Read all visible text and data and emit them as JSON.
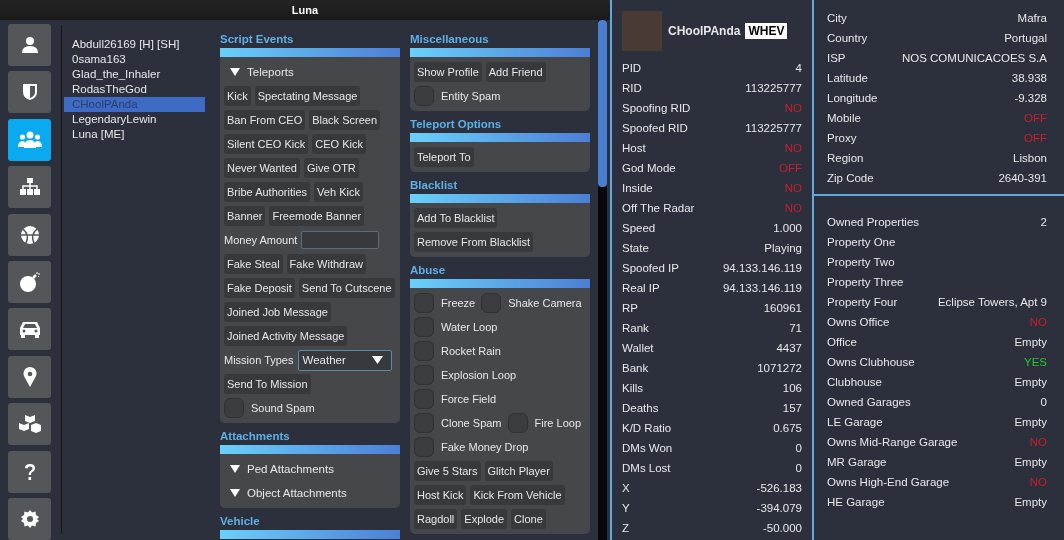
{
  "window": {
    "title": "Luna"
  },
  "sidebar": [
    {
      "kind": "person",
      "selected": false
    },
    {
      "kind": "shield",
      "selected": false
    },
    {
      "kind": "group",
      "selected": true
    },
    {
      "kind": "tree",
      "selected": false
    },
    {
      "kind": "ball",
      "selected": false
    },
    {
      "kind": "bomb",
      "selected": false
    },
    {
      "kind": "car",
      "selected": false
    },
    {
      "kind": "pin",
      "selected": false
    },
    {
      "kind": "boxes",
      "selected": false
    },
    {
      "kind": "help",
      "selected": false
    },
    {
      "kind": "gear",
      "selected": false
    }
  ],
  "players": [
    {
      "name": "Abdull26169 [H] [SH]",
      "selected": false
    },
    {
      "name": "0sama163",
      "selected": false
    },
    {
      "name": "Glad_the_Inhaler",
      "selected": false
    },
    {
      "name": "RodasTheGod",
      "selected": false
    },
    {
      "name": "CHoolPAnda",
      "selected": true
    },
    {
      "name": "LegendaryLewin",
      "selected": false
    },
    {
      "name": "Luna [ME]",
      "selected": false
    }
  ],
  "columns": [
    [
      {
        "title": "Script Events",
        "rows": [
          [
            {
              "kind": "expander",
              "label": "Teleports"
            }
          ],
          [
            {
              "kind": "button",
              "label": "Kick"
            },
            {
              "kind": "button",
              "label": "Spectating Message"
            }
          ],
          [
            {
              "kind": "button",
              "label": "Ban From CEO"
            },
            {
              "kind": "button",
              "label": "Black Screen"
            }
          ],
          [
            {
              "kind": "button",
              "label": "Silent CEO Kick"
            },
            {
              "kind": "button",
              "label": "CEO Kick"
            }
          ],
          [
            {
              "kind": "button",
              "label": "Never Wanted"
            },
            {
              "kind": "button",
              "label": "Give OTR"
            }
          ],
          [
            {
              "kind": "button",
              "label": "Bribe Authorities"
            },
            {
              "kind": "button",
              "label": "Veh Kick"
            }
          ],
          [
            {
              "kind": "button",
              "label": "Banner"
            },
            {
              "kind": "button",
              "label": "Freemode Banner"
            }
          ],
          [
            {
              "kind": "label",
              "label": "Money Amount"
            },
            {
              "kind": "field"
            }
          ],
          [
            {
              "kind": "button",
              "label": "Fake Steal"
            },
            {
              "kind": "button",
              "label": "Fake Withdraw"
            }
          ],
          [
            {
              "kind": "button",
              "label": "Fake Deposit"
            },
            {
              "kind": "button",
              "label": "Send To Cutscene"
            }
          ],
          [
            {
              "kind": "button",
              "label": "Joined Job Message"
            }
          ],
          [
            {
              "kind": "button",
              "label": "Joined Activity Message"
            }
          ],
          [
            {
              "kind": "label",
              "label": "Mission Types"
            },
            {
              "kind": "dropdown",
              "label": "Weather"
            }
          ],
          [
            {
              "kind": "button",
              "label": "Send To Mission"
            }
          ],
          [
            {
              "kind": "checkbox",
              "label": "Sound Spam",
              "checked": false
            }
          ]
        ]
      },
      {
        "title": "Attachments",
        "rows": [
          [
            {
              "kind": "expander",
              "label": "Ped Attachments"
            }
          ],
          [
            {
              "kind": "expander",
              "label": "Object Attachments"
            }
          ]
        ]
      },
      {
        "title": "Vehicle"
      }
    ],
    [
      {
        "title": "Miscellaneous",
        "rows": [
          [
            {
              "kind": "button",
              "label": "Show Profile"
            },
            {
              "kind": "button",
              "label": "Add Friend"
            }
          ],
          [
            {
              "kind": "checkbox",
              "label": "Entity Spam",
              "checked": false
            }
          ]
        ]
      },
      {
        "title": "Teleport Options",
        "rows": [
          [
            {
              "kind": "button",
              "label": "Teleport To"
            }
          ]
        ]
      },
      {
        "title": "Blacklist",
        "rows": [
          [
            {
              "kind": "button",
              "label": "Add To Blacklist"
            }
          ],
          [
            {
              "kind": "button",
              "label": "Remove From Blacklist"
            }
          ]
        ]
      },
      {
        "title": "Abuse",
        "rows": [
          [
            {
              "kind": "checkbox",
              "label": "Freeze",
              "checked": false
            },
            {
              "kind": "checkbox",
              "label": "Shake Camera",
              "checked": false
            }
          ],
          [
            {
              "kind": "checkbox",
              "label": "Water Loop",
              "checked": false
            }
          ],
          [
            {
              "kind": "checkbox",
              "label": "Rocket Rain",
              "checked": false
            }
          ],
          [
            {
              "kind": "checkbox",
              "label": "Explosion Loop",
              "checked": false
            }
          ],
          [
            {
              "kind": "checkbox",
              "label": "Force Field",
              "checked": false
            }
          ],
          [
            {
              "kind": "checkbox",
              "label": "Clone Spam",
              "checked": false
            },
            {
              "kind": "checkbox",
              "label": "Fire Loop",
              "checked": false
            }
          ],
          [
            {
              "kind": "checkbox",
              "label": "Fake Money Drop",
              "checked": false
            }
          ],
          [
            {
              "kind": "button",
              "label": "Give 5 Stars"
            },
            {
              "kind": "button",
              "label": "Glitch Player"
            }
          ],
          [
            {
              "kind": "button",
              "label": "Host Kick"
            },
            {
              "kind": "button",
              "label": "Kick From Vehicle"
            }
          ],
          [
            {
              "kind": "button",
              "label": "Ragdoll"
            },
            {
              "kind": "button",
              "label": "Explode"
            },
            {
              "kind": "button",
              "label": "Clone"
            }
          ]
        ]
      }
    ]
  ],
  "player_info": {
    "name": "CHoolPAnda",
    "tag": "WHEV",
    "stats": [
      {
        "label": "PID",
        "value": "4"
      },
      {
        "label": "RID",
        "value": "113225777"
      },
      {
        "label": "Spoofing RID",
        "value": "NO",
        "color": "#c8202a"
      },
      {
        "label": "Spoofed RID",
        "value": "113225777"
      },
      {
        "label": "Host",
        "value": "NO",
        "color": "#c8202a"
      },
      {
        "label": "God Mode",
        "value": "OFF",
        "color": "#c8202a"
      },
      {
        "label": "Inside",
        "value": "NO",
        "color": "#c8202a"
      },
      {
        "label": "Off The Radar",
        "value": "NO",
        "color": "#c8202a"
      },
      {
        "label": "Speed",
        "value": "1.000"
      },
      {
        "label": "State",
        "value": "Playing"
      },
      {
        "label": "Spoofed IP",
        "value": "94.133.146.119"
      },
      {
        "label": "Real IP",
        "value": "94.133.146.119"
      },
      {
        "label": "RP",
        "value": "160961"
      },
      {
        "label": "Rank",
        "value": "71"
      },
      {
        "label": "Wallet",
        "value": "4437"
      },
      {
        "label": "Bank",
        "value": "1071272"
      },
      {
        "label": "Kills",
        "value": "106"
      },
      {
        "label": "Deaths",
        "value": "157"
      },
      {
        "label": "K/D Ratio",
        "value": "0.675"
      },
      {
        "label": "DMs Won",
        "value": "0"
      },
      {
        "label": "DMs Lost",
        "value": "0"
      },
      {
        "label": "X",
        "value": "-526.183"
      },
      {
        "label": "Y",
        "value": "-394.079"
      },
      {
        "label": "Z",
        "value": "-50.000"
      }
    ]
  },
  "location": [
    {
      "label": "City",
      "value": "Mafra"
    },
    {
      "label": "Country",
      "value": "Portugal"
    },
    {
      "label": "ISP",
      "value": "NOS COMUNICACOES S.A"
    },
    {
      "label": "Latitude",
      "value": "38.938"
    },
    {
      "label": "Longitude",
      "value": "-9.328"
    },
    {
      "label": "Mobile",
      "value": "OFF",
      "color": "#c8202a"
    },
    {
      "label": "Proxy",
      "value": "OFF",
      "color": "#c8202a"
    },
    {
      "label": "Region",
      "value": "Lisbon"
    },
    {
      "label": "Zip Code",
      "value": "2640-391"
    }
  ],
  "properties": [
    {
      "label": "Owned Properties",
      "value": "2"
    },
    {
      "label": "Property One"
    },
    {
      "label": "Property Two"
    },
    {
      "label": "Property Three"
    },
    {
      "label": "Property Four",
      "value": "Eclipse Towers, Apt 9"
    },
    {
      "label": "Owns Office",
      "value": "NO",
      "color": "#c8202a"
    },
    {
      "label": "Office",
      "value": "Empty"
    },
    {
      "label": "Owns Clubhouse",
      "value": "YES",
      "color": "#2bc42b"
    },
    {
      "label": "Clubhouse",
      "value": "Empty"
    },
    {
      "label": "Owned Garages",
      "value": "0"
    },
    {
      "label": "LE Garage",
      "value": "Empty"
    },
    {
      "label": "Owns Mid-Range Garage",
      "value": "NO",
      "color": "#c8202a"
    },
    {
      "label": "MR Garage",
      "value": "Empty"
    },
    {
      "label": "Owns High-End Garage",
      "value": "NO",
      "color": "#c8202a"
    },
    {
      "label": "HE Garage",
      "value": "Empty"
    }
  ]
}
